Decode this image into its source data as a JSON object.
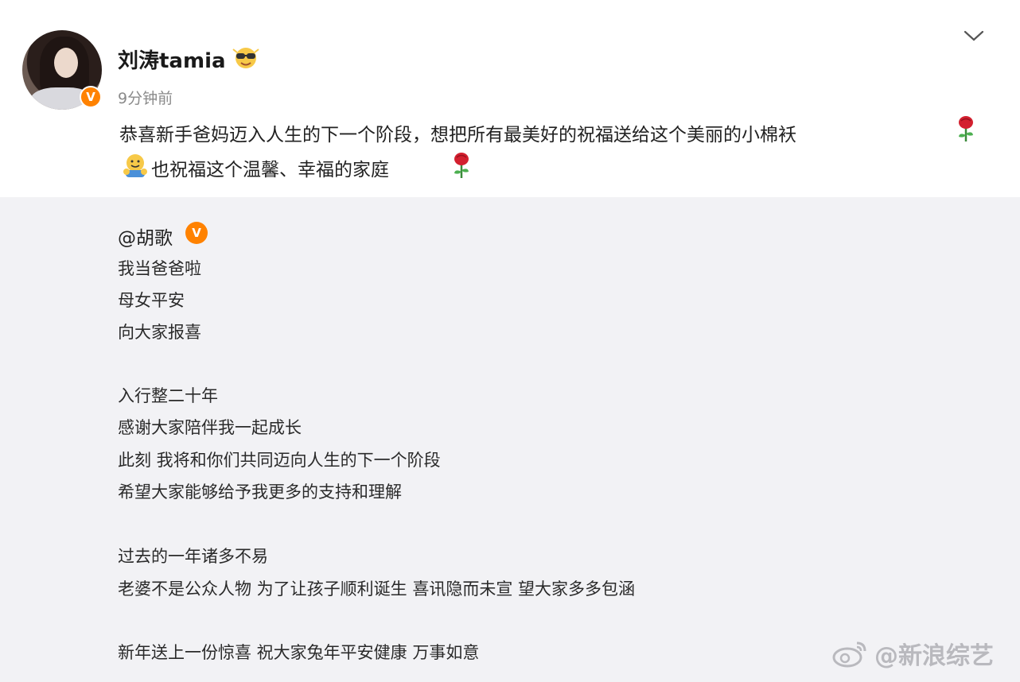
{
  "post": {
    "username": "刘涛tamia",
    "time": "9分钟前",
    "text_line1": "恭喜新手爸妈迈入人生的下一个阶段，想把所有最美好的祝福送给这个美丽的小棉袄",
    "text_line2": "也祝福这个温馨、幸福的家庭",
    "icons": [
      "avatar",
      "verified-badge-icon",
      "sunglasses-emoji-icon",
      "chevron-down-icon",
      "rose-emoji-icon",
      "hug-emoji-icon"
    ]
  },
  "repost": {
    "mention": "@胡歌",
    "lines": [
      "我当爸爸啦",
      "母女平安",
      "向大家报喜",
      "",
      "入行整二十年",
      "感谢大家陪伴我一起成长",
      "此刻 我将和你们共同迈向人生的下一个阶段",
      "希望大家能够给予我更多的支持和理解",
      "",
      "过去的一年诸多不易",
      "老婆不是公众人物 为了让孩子顺利诞生 喜讯隐而未宣 望大家多多包涵",
      "",
      "新年送上一份惊喜 祝大家兔年平安健康 万事如意"
    ]
  },
  "watermark": {
    "text": "@新浪综艺",
    "icon": "weibo-logo-icon"
  },
  "colors": {
    "verified": "#ff8200",
    "repost_bg": "#f2f2f5",
    "time": "#8a8a8a"
  }
}
